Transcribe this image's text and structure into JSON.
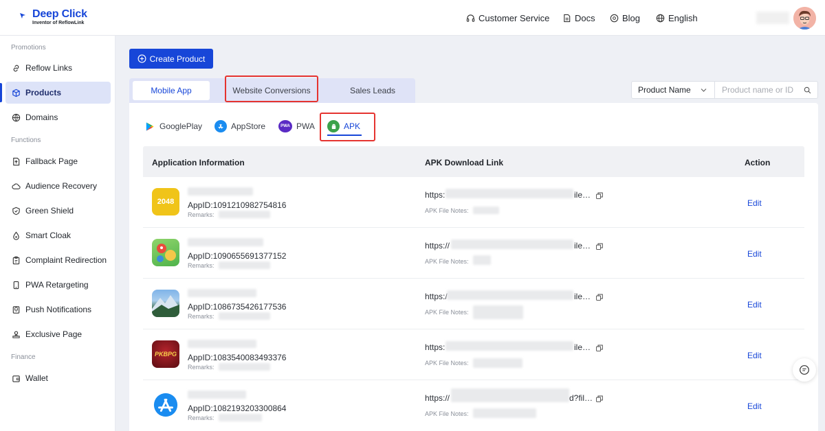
{
  "brand": {
    "name": "Deep Click",
    "tagline": "Inventor of ReflowLink",
    "color": "#1746d8"
  },
  "header": {
    "nav": [
      {
        "label": "Customer Service",
        "icon": "headset-icon"
      },
      {
        "label": "Docs",
        "icon": "document-icon"
      },
      {
        "label": "Blog",
        "icon": "blog-icon"
      },
      {
        "label": "English",
        "icon": "globe-icon"
      }
    ]
  },
  "sidebar": {
    "sections": [
      {
        "title": "Promotions"
      },
      {
        "title": "Functions"
      },
      {
        "title": "Finance"
      }
    ],
    "items": [
      {
        "label": "Reflow Links",
        "icon": "link-icon"
      },
      {
        "label": "Products",
        "icon": "cube-icon",
        "active": true
      },
      {
        "label": "Domains",
        "icon": "globe-icon"
      },
      {
        "label": "Fallback Page",
        "icon": "page-icon"
      },
      {
        "label": "Audience Recovery",
        "icon": "cloud-icon"
      },
      {
        "label": "Green Shield",
        "icon": "shield-icon"
      },
      {
        "label": "Smart Cloak",
        "icon": "drop-icon"
      },
      {
        "label": "Complaint Redirection",
        "icon": "clipboard-icon"
      },
      {
        "label": "PWA Retargeting",
        "icon": "phone-icon"
      },
      {
        "label": "Push Notifications",
        "icon": "bell-icon"
      },
      {
        "label": "Exclusive Page",
        "icon": "crown-icon"
      },
      {
        "label": "Wallet",
        "icon": "wallet-icon"
      }
    ]
  },
  "main": {
    "create_button": "Create Product",
    "tabs": [
      "Mobile App",
      "Website Conversions",
      "Sales Leads"
    ],
    "filter": {
      "select_value": "Product Name",
      "placeholder": "Product name or ID"
    },
    "platform_tabs": [
      "GooglePlay",
      "AppStore",
      "PWA",
      "APK"
    ],
    "pwa_badge": "PWA",
    "table": {
      "columns": [
        "Application Information",
        "APK Download Link",
        "Action"
      ],
      "rows": [
        {
          "icon_text": "2048",
          "app_id": "AppID:1091210982754816",
          "remarks": "Remarks:",
          "link_pre": "https:",
          "link_post": "ile…",
          "notes": "APK File Notes:",
          "action": "Edit"
        },
        {
          "icon_text": "",
          "app_id": "AppID:1090655691377152",
          "remarks": "Remarks:",
          "link_pre": "https://",
          "link_post": "ile…",
          "notes": "APK File Notes:",
          "action": "Edit"
        },
        {
          "icon_text": "",
          "app_id": "AppID:1086735426177536",
          "remarks": "Remarks:",
          "link_pre": "https:/",
          "link_post": "ile…",
          "notes": "APK File Notes:",
          "action": "Edit"
        },
        {
          "icon_text": "PKBPG",
          "app_id": "AppID:1083540083493376",
          "remarks": "Remarks:",
          "link_pre": "https:",
          "link_post": "ile…",
          "notes": "APK File Notes:",
          "action": "Edit"
        },
        {
          "icon_text": "",
          "app_id": "AppID:1082193203300864",
          "remarks": "Remarks:",
          "link_pre": "https://",
          "link_post": "d?fil…",
          "notes": "APK File Notes:",
          "action": "Edit"
        }
      ]
    }
  }
}
